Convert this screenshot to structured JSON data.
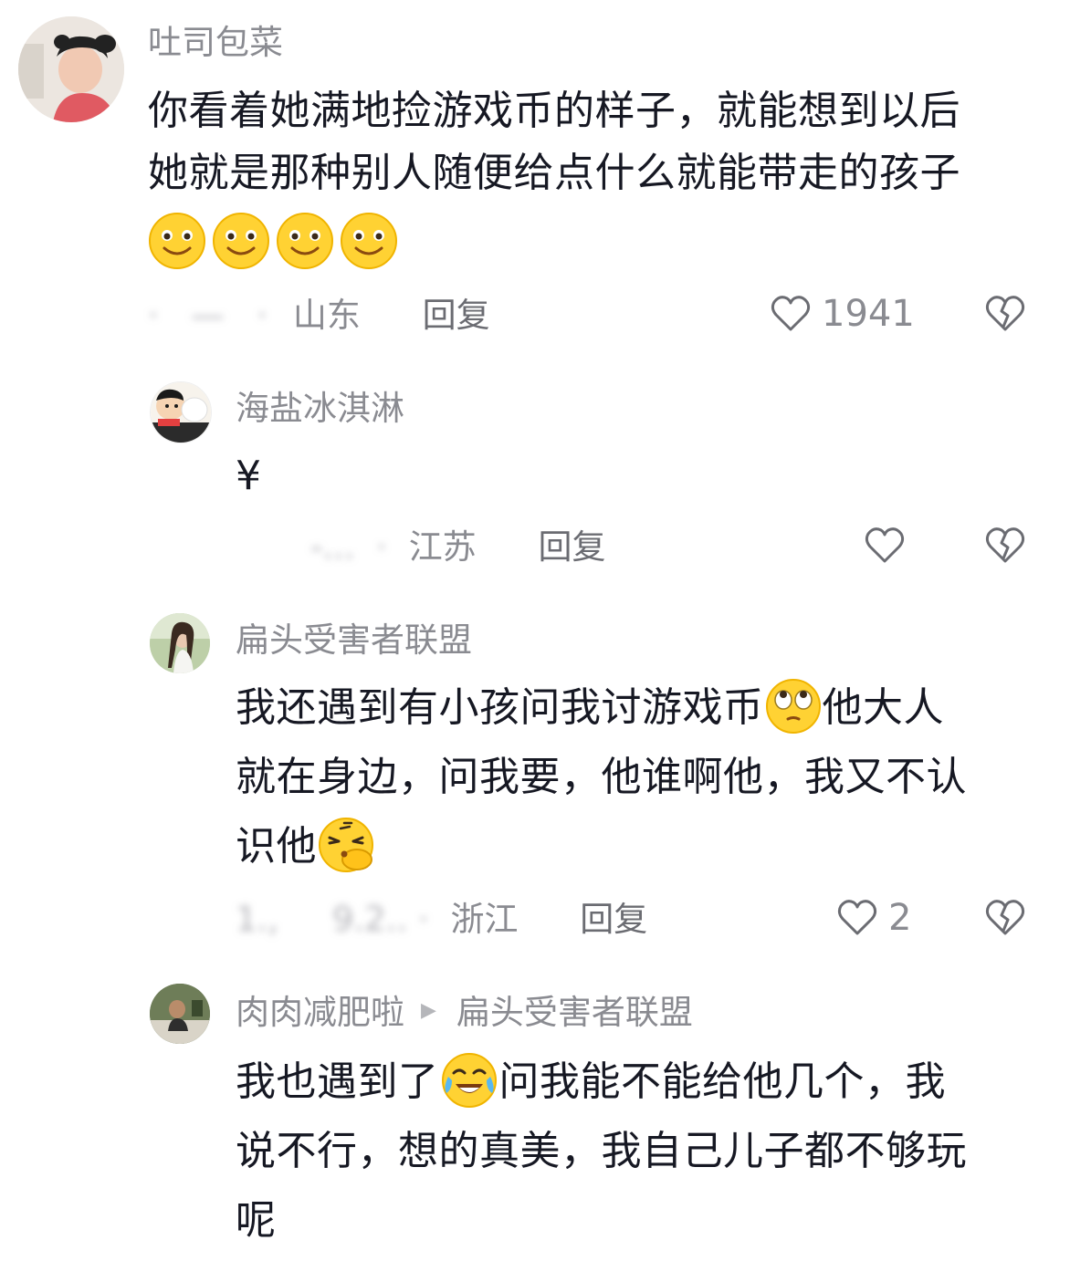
{
  "comments": [
    {
      "username": "吐司包菜",
      "lines": [
        "你看着她满地捡游戏币的样子，就能想到以后",
        "她就是那种别人随便给点什么就能带走的孩子"
      ],
      "emojis": [
        "smile-emoji",
        "smile-emoji",
        "smile-emoji",
        "smile-emoji"
      ],
      "location": "山东",
      "reply_label": "回复",
      "like_count": "1941"
    },
    {
      "username": "海盐冰淇淋",
      "lines": [
        "¥"
      ],
      "location": "江苏",
      "reply_label": "回复",
      "like_count": ""
    },
    {
      "username": "扁头受害者联盟",
      "line1_a": "我还遇到有小孩问我讨游戏币",
      "line1_b": "他大人",
      "line2": "就在身边，问我要，他谁啊他，我又不认",
      "line3": "识他",
      "emojis": [
        "eye-roll-emoji",
        "thinking-hand-emoji"
      ],
      "location": "浙江",
      "reply_label": "回复",
      "like_count": "2"
    },
    {
      "username": "肉肉减肥啦",
      "reply_to": "扁头受害者联盟",
      "line1_a": "我也遇到了",
      "line1_b": "问我能不能给他几个，我",
      "line2": "说不行，想的真美，我自己儿子都不够玩",
      "line3": "呢",
      "emojis": [
        "crying-laughing-emoji"
      ]
    }
  ],
  "colors": {
    "text": "#161823",
    "secondary": "#8a8b91",
    "emoji_yellow": "#ffd233"
  }
}
